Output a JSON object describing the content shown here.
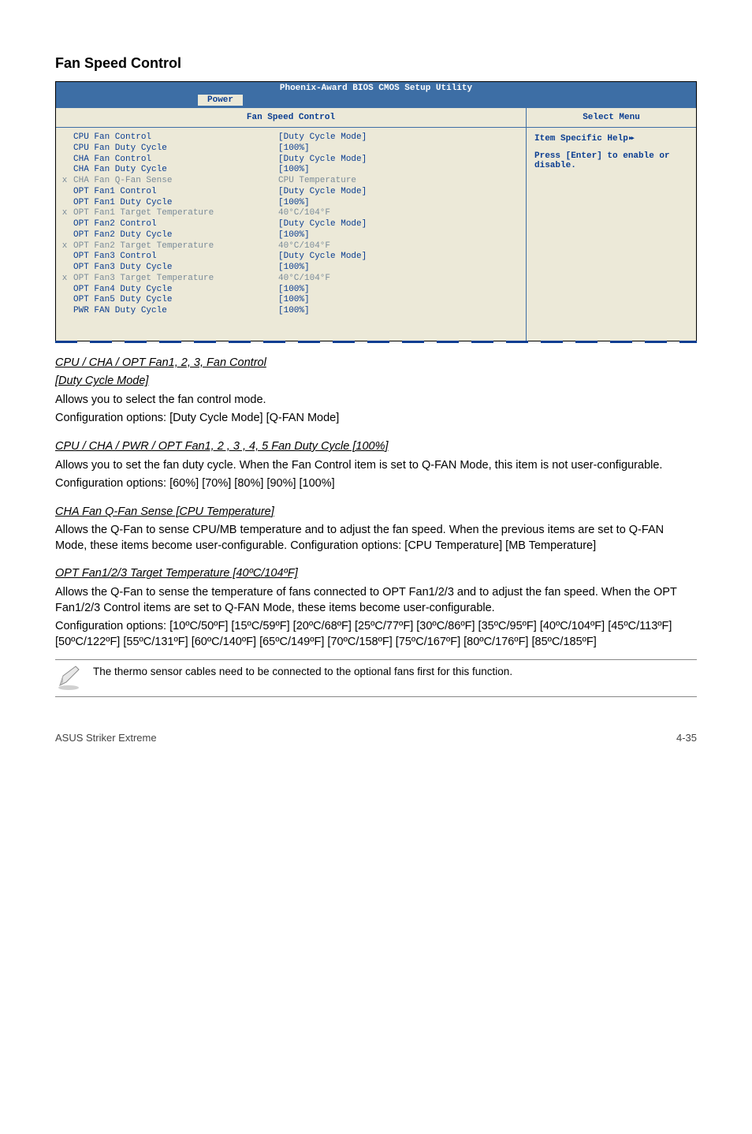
{
  "heading": "Fan Speed Control",
  "bios": {
    "title": "Phoenix-Award BIOS CMOS Setup Utility",
    "tab": "Power",
    "left_heading": "Fan Speed Control",
    "right_heading": "Select Menu",
    "rows": [
      {
        "x": "",
        "label": "CPU Fan Control",
        "val": "[Duty Cycle Mode]",
        "dim": false
      },
      {
        "x": "",
        "label": "CPU Fan Duty Cycle",
        "val": "[100%]",
        "dim": false
      },
      {
        "x": "",
        "label": "CHA Fan Control",
        "val": "[Duty Cycle Mode]",
        "dim": false
      },
      {
        "x": "",
        "label": "CHA Fan Duty Cycle",
        "val": "[100%]",
        "dim": false
      },
      {
        "x": "x",
        "label": "CHA Fan Q-Fan Sense",
        "val": "CPU Temperature",
        "dim": true
      },
      {
        "x": "",
        "label": "OPT Fan1 Control",
        "val": "[Duty Cycle Mode]",
        "dim": false
      },
      {
        "x": "",
        "label": "OPT Fan1 Duty Cycle",
        "val": "[100%]",
        "dim": false
      },
      {
        "x": "x",
        "label": "OPT Fan1 Target Temperature",
        "val": "40°C/104°F",
        "dim": true
      },
      {
        "x": "",
        "label": "OPT Fan2 Control",
        "val": "[Duty Cycle Mode]",
        "dim": false
      },
      {
        "x": "",
        "label": "OPT Fan2 Duty Cycle",
        "val": "[100%]",
        "dim": false
      },
      {
        "x": "x",
        "label": "OPT Fan2 Target Temperature",
        "val": "40°C/104°F",
        "dim": true
      },
      {
        "x": "",
        "label": "OPT Fan3 Control",
        "val": "[Duty Cycle Mode]",
        "dim": false
      },
      {
        "x": "",
        "label": "OPT Fan3 Duty Cycle",
        "val": "[100%]",
        "dim": false
      },
      {
        "x": "x",
        "label": "OPT Fan3 Target Temperature",
        "val": "40°C/104°F",
        "dim": true
      },
      {
        "x": "",
        "label": "OPT Fan4 Duty Cycle",
        "val": "[100%]",
        "dim": false
      },
      {
        "x": "",
        "label": "OPT Fan5 Duty Cycle",
        "val": "[100%]",
        "dim": false
      },
      {
        "x": "",
        "label": "PWR FAN Duty Cycle",
        "val": "[100%]",
        "dim": false
      }
    ],
    "help_line1": "Item Specific Help",
    "help_line2": "Press [Enter] to enable or disable."
  },
  "sections": {
    "s1": {
      "title1": "CPU / CHA / OPT Fan1, 2, 3, Fan Control ",
      "title2": "[Duty Cycle Mode]",
      "p1": "Allows you to select the fan control mode.",
      "p2": "Configuration options: [Duty Cycle Mode] [Q-FAN Mode]"
    },
    "s2": {
      "title": "CPU / CHA / PWR / OPT Fan1, 2 , 3 , 4, 5 Fan Duty Cycle [100%]",
      "p1": "Allows you to set the fan duty cycle.  When the Fan Control item is set to Q-FAN Mode, this item is not user-configurable.",
      "p2": "Configuration options: [60%] [70%] [80%] [90%] [100%]"
    },
    "s3": {
      "title": "CHA Fan Q-Fan Sense [CPU Temperature]",
      "p1": "Allows the Q-Fan to sense CPU/MB temperature and to adjust the fan speed. When the previous items are set to Q-FAN Mode, these items become user-configurable. Configuration options: [CPU Temperature] [MB Temperature]"
    },
    "s4": {
      "title": "OPT Fan1/2/3 Target Temperature [40ºC/104ºF] ",
      "p1": "Allows the Q-Fan to sense the temperature of fans connected to OPT Fan1/2/3 and to adjust the fan speed. When the OPT Fan1/2/3 Control items are set to Q-FAN Mode, these items become user-configurable.",
      "p2": "Configuration options: [10ºC/50ºF] [15ºC/59ºF] [20ºC/68ºF] [25ºC/77ºF] [30ºC/86ºF] [35ºC/95ºF] [40ºC/104ºF] [45ºC/113ºF] [50ºC/122ºF] [55ºC/131ºF] [60ºC/140ºF] [65ºC/149ºF] [70ºC/158ºF] [75ºC/167ºF] [80ºC/176ºF] [85ºC/185ºF]"
    }
  },
  "note": "The thermo sensor cables need to be connected to the optional fans first for this function.",
  "footer_left": "ASUS Striker Extreme",
  "footer_right": "4-35"
}
